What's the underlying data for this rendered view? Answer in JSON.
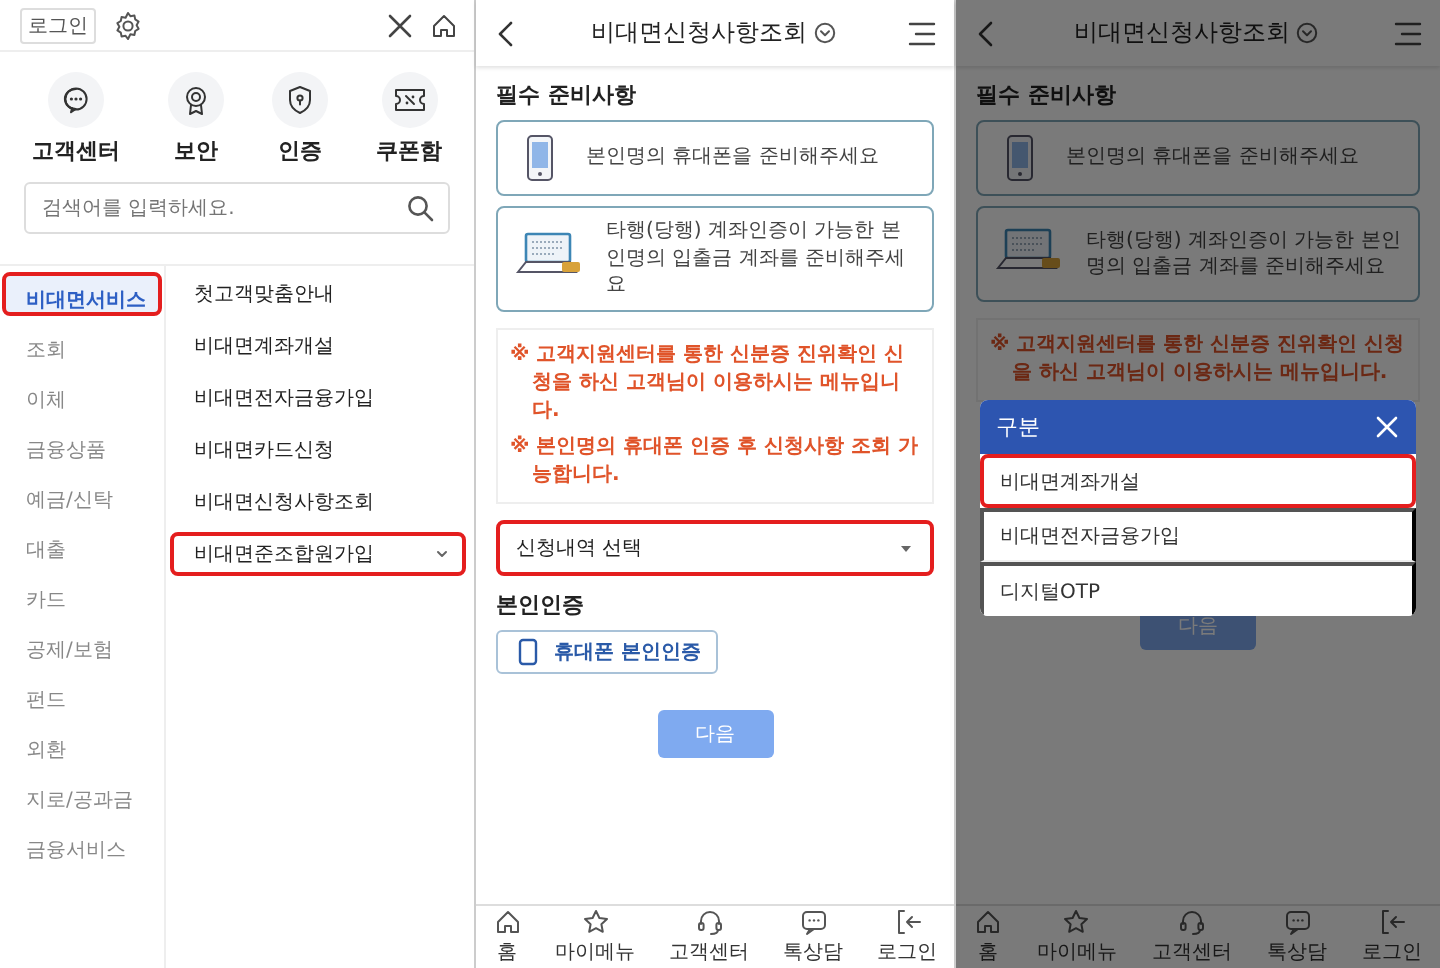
{
  "menu_panel": {
    "login_button": "로그인",
    "quick_links": [
      {
        "label": "고객센터",
        "kind": "chat"
      },
      {
        "label": "보안",
        "kind": "medal"
      },
      {
        "label": "인증",
        "kind": "shield"
      },
      {
        "label": "쿠폰함",
        "kind": "coupon"
      }
    ],
    "search": {
      "placeholder": "검색어를 입력하세요."
    },
    "categories": [
      {
        "label": "비대면서비스",
        "selected": true,
        "annotated": true
      },
      {
        "label": "조회",
        "selected": false,
        "annotated": false
      },
      {
        "label": "이체",
        "selected": false,
        "annotated": false
      },
      {
        "label": "금융상품",
        "selected": false,
        "annotated": false
      },
      {
        "label": "예금/신탁",
        "selected": false,
        "annotated": false
      },
      {
        "label": "대출",
        "selected": false,
        "annotated": false
      },
      {
        "label": "카드",
        "selected": false,
        "annotated": false
      },
      {
        "label": "공제/보험",
        "selected": false,
        "annotated": false
      },
      {
        "label": "펀드",
        "selected": false,
        "annotated": false
      },
      {
        "label": "외환",
        "selected": false,
        "annotated": false
      },
      {
        "label": "지로/공과금",
        "selected": false,
        "annotated": false
      },
      {
        "label": "금융서비스",
        "selected": false,
        "annotated": false
      }
    ],
    "sub_items": [
      {
        "label": "첫고객맞춤안내",
        "expandable": false,
        "annotated": false
      },
      {
        "label": "비대면계좌개설",
        "expandable": false,
        "annotated": false
      },
      {
        "label": "비대면전자금융가입",
        "expandable": false,
        "annotated": false
      },
      {
        "label": "비대면카드신청",
        "expandable": false,
        "annotated": false
      },
      {
        "label": "비대면신청사항조회",
        "expandable": false,
        "annotated": false
      },
      {
        "label": "비대면준조합원가입",
        "expandable": true,
        "annotated": true
      }
    ]
  },
  "form_screen": {
    "title": "비대면신청사항조회",
    "prep_title": "필수 준비사항",
    "prep_cards": [
      {
        "text": "본인명의 휴대폰을 준비해주세요",
        "kind": "phone"
      },
      {
        "text": "타행(당행) 계좌인증이 가능한 본인명의 입출금 계좌를 준비해주세요",
        "kind": "laptop"
      }
    ],
    "notices": [
      "※ 고객지원센터를 통한 신분증 진위확인 신청을 하신 고객님이 이용하시는 메뉴입니다.",
      "※ 본인명의 휴대폰 인증 후 신청사항 조회 가능합니다."
    ],
    "select": {
      "value": "신청내역 선택",
      "annotated": true
    },
    "auth_title": "본인인증",
    "auth_button": "휴대폰 본인인증",
    "next_button": "다음",
    "nav": [
      {
        "label": "홈",
        "kind": "home"
      },
      {
        "label": "마이메뉴",
        "kind": "star"
      },
      {
        "label": "고객센터",
        "kind": "headset"
      },
      {
        "label": "톡상담",
        "kind": "chat"
      },
      {
        "label": "로그인",
        "kind": "login"
      }
    ]
  },
  "popup_screen": {
    "title": "비대면신청사항조회",
    "prep_title": "필수 준비사항",
    "prep_cards": [
      {
        "text": "본인명의 휴대폰을 준비해주세요",
        "kind": "phone"
      },
      {
        "text": "타행(당행) 계좌인증이 가능한 본인명의 입출금 계좌를 준비해주세요",
        "kind": "laptop"
      }
    ],
    "notices": [
      "※ 고객지원센터를 통한 신분증 진위확인 신청을 하신 고객님이 이용하시는 메뉴입니다."
    ],
    "next_button": "다음",
    "nav": [
      {
        "label": "홈",
        "kind": "home"
      },
      {
        "label": "마이메뉴",
        "kind": "star"
      },
      {
        "label": "고객센터",
        "kind": "headset"
      },
      {
        "label": "톡상담",
        "kind": "chat"
      },
      {
        "label": "로그인",
        "kind": "login"
      }
    ],
    "popup": {
      "title": "구분",
      "options": [
        {
          "label": "비대면계좌개설",
          "annotated": true
        },
        {
          "label": "비대면전자금융가입",
          "annotated": false
        },
        {
          "label": "디지털OTP",
          "annotated": false
        }
      ]
    }
  }
}
